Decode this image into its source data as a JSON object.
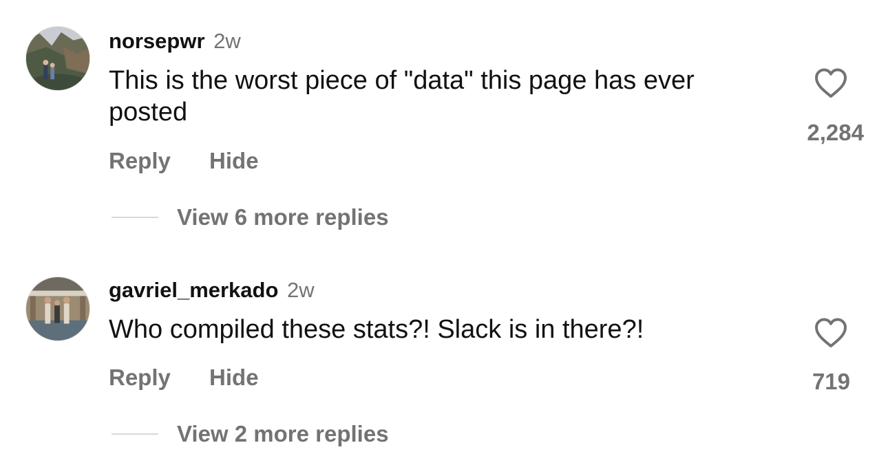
{
  "colors": {
    "text_primary": "#111111",
    "text_secondary": "#737373",
    "divider": "#d7d7d7",
    "heart_stroke": "#737373"
  },
  "comments": [
    {
      "username": "norsepwr",
      "time": "2w",
      "text": "This is the worst piece of \"data\" this page has ever posted",
      "reply_label": "Reply",
      "hide_label": "Hide",
      "more_replies_label": "View 6 more replies",
      "likes": "2,284",
      "avatar_icon": "avatar-photo-canyon",
      "like_icon": "heart-outline-icon"
    },
    {
      "username": "gavriel_merkado",
      "time": "2w",
      "text": "Who compiled these stats?! Slack is in there?!",
      "reply_label": "Reply",
      "hide_label": "Hide",
      "more_replies_label": "View 2 more replies",
      "likes": "719",
      "avatar_icon": "avatar-photo-group",
      "like_icon": "heart-outline-icon"
    }
  ]
}
